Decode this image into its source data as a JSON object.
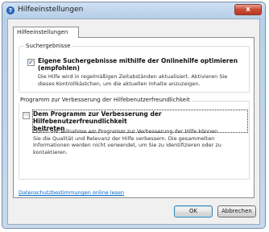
{
  "window": {
    "title": "Hilfeeinstellungen",
    "close_glyph": "x",
    "icon": "help-icon"
  },
  "tab": {
    "label": "Hilfeeinstellungen"
  },
  "search_group": {
    "legend": "Suchergebnisse",
    "checkbox": {
      "checked": true,
      "label_line1": "Eigene Suchergebnisse mithilfe der Onlinehilfe optimieren",
      "label_line2": "(empfohlen)"
    },
    "description_line1": "Die Hilfe wird in regelmäßigen Zeitabständen aktualisiert. Aktivieren Sie",
    "description_line2": "dieses Kontrollkästchen, um die aktuellen Inhalte anzuzeigen."
  },
  "improvement_group": {
    "legend": "Programm zur Verbesserung der Hilfebenutzerfreundlichkeit",
    "checkbox": {
      "checked": false,
      "label_line1": "Dem Programm zur Verbesserung der Hilfebenutzerfreundlichkeit",
      "label_line2": "beitreten"
    },
    "description_line1": "Durch die Teilnahme am Programm zur Verbesserung der Hilfe können",
    "description_line2": "Sie die Qualität und Relevanz der Hilfe verbessern. Die gesammelten",
    "description_line3": "Informationen werden nicht verwendet, um Sie zu identifizieren oder zu",
    "description_line4": "kontaktieren."
  },
  "privacy_link": "Datenschutzbestimmungen online lesen",
  "buttons": {
    "ok": "OK",
    "cancel": "Abbrechen"
  }
}
